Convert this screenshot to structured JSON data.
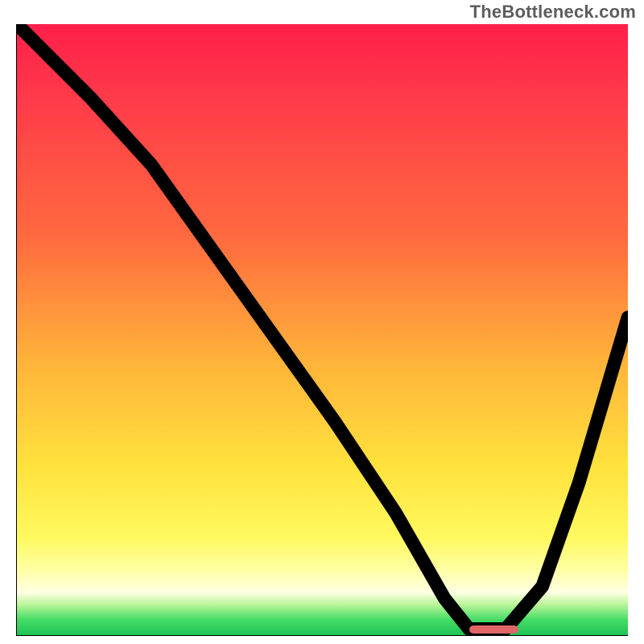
{
  "watermark": "TheBottleneck.com",
  "chart_data": {
    "type": "line",
    "title": "",
    "xlabel": "",
    "ylabel": "",
    "xlim": [
      0,
      100
    ],
    "ylim": [
      0,
      100
    ],
    "grid": false,
    "legend": false,
    "background": {
      "type": "vertical-gradient",
      "stops": [
        {
          "pct": 0,
          "color": "#ff1f4a"
        },
        {
          "pct": 12,
          "color": "#ff3a4a"
        },
        {
          "pct": 35,
          "color": "#ff6a3e"
        },
        {
          "pct": 55,
          "color": "#ffb23a"
        },
        {
          "pct": 72,
          "color": "#ffe13c"
        },
        {
          "pct": 84,
          "color": "#fff95e"
        },
        {
          "pct": 89,
          "color": "#ffffa0"
        },
        {
          "pct": 93,
          "color": "#ffffe3"
        },
        {
          "pct": 95,
          "color": "#b9f598"
        },
        {
          "pct": 97.5,
          "color": "#44dc66"
        },
        {
          "pct": 100,
          "color": "#1ec455"
        }
      ]
    },
    "series": [
      {
        "name": "bottleneck-curve",
        "x": [
          0,
          5,
          12,
          22,
          32,
          42,
          52,
          62,
          70,
          74,
          80,
          86,
          92,
          100
        ],
        "y": [
          100,
          95,
          88,
          77,
          63,
          49,
          35,
          20,
          6,
          1,
          1,
          8,
          25,
          52
        ]
      }
    ],
    "annotations": [
      {
        "type": "pill-marker",
        "name": "optimal-range",
        "x_start": 74,
        "x_end": 82,
        "y": 1,
        "color": "#e06666"
      }
    ]
  }
}
